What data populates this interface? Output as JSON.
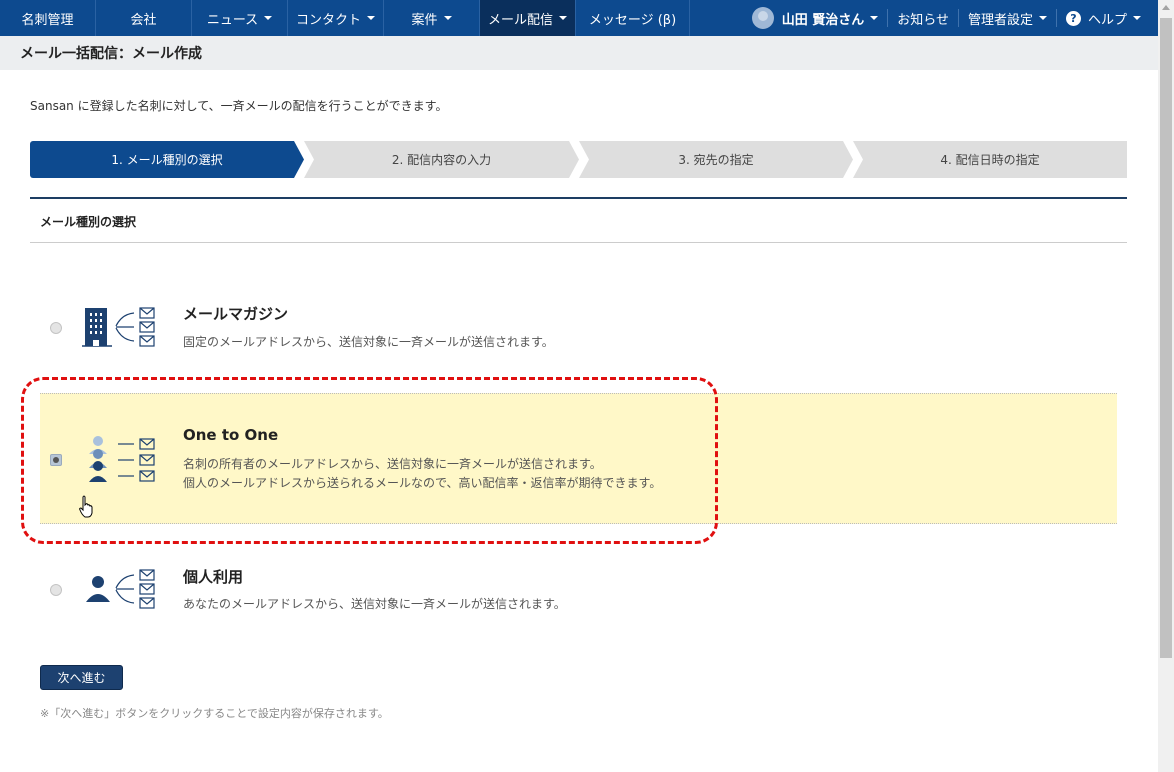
{
  "nav": {
    "items": [
      {
        "label": "名刺管理",
        "dropdown": false
      },
      {
        "label": "会社",
        "dropdown": false
      },
      {
        "label": "ニュース",
        "dropdown": true
      },
      {
        "label": "コンタクト",
        "dropdown": true
      },
      {
        "label": "案件",
        "dropdown": true
      },
      {
        "label": "メール配信",
        "dropdown": true,
        "active": true
      },
      {
        "label": "メッセージ (β)",
        "dropdown": false
      }
    ],
    "user": "山田 賢治さん",
    "notice": "お知らせ",
    "admin": "管理者設定",
    "help": "ヘルプ",
    "help_icon": "?"
  },
  "page_title": "メール一括配信：メール作成",
  "intro": "Sansan に登録した名刺に対して、一斉メールの配信を行うことができます。",
  "steps": [
    "1. メール種別の選択",
    "2. 配信内容の入力",
    "3. 宛先の指定",
    "4. 配信日時の指定"
  ],
  "section_heading": "メール種別の選択",
  "options": [
    {
      "title": "メールマガジン",
      "desc": [
        "固定のメールアドレスから、送信対象に一斉メールが送信されます。"
      ],
      "icon": "building-mail-icon"
    },
    {
      "title": "One to One",
      "desc": [
        "名刺の所有者のメールアドレスから、送信対象に一斉メールが送信されます。",
        "個人のメールアドレスから送られるメールなので、高い配信率・返信率が期待できます。"
      ],
      "icon": "people-mail-icon",
      "selected": true
    },
    {
      "title": "個人利用",
      "desc": [
        "あなたのメールアドレスから、送信対象に一斉メールが送信されます。"
      ],
      "icon": "person-mail-icon"
    }
  ],
  "next_button": "次へ進む",
  "note": "※「次へ進む」ボタンをクリックすることで設定内容が保存されます。",
  "colors": {
    "nav": "#0d4a8f",
    "highlight": "#fff8c8",
    "annotation": "#e01010"
  }
}
